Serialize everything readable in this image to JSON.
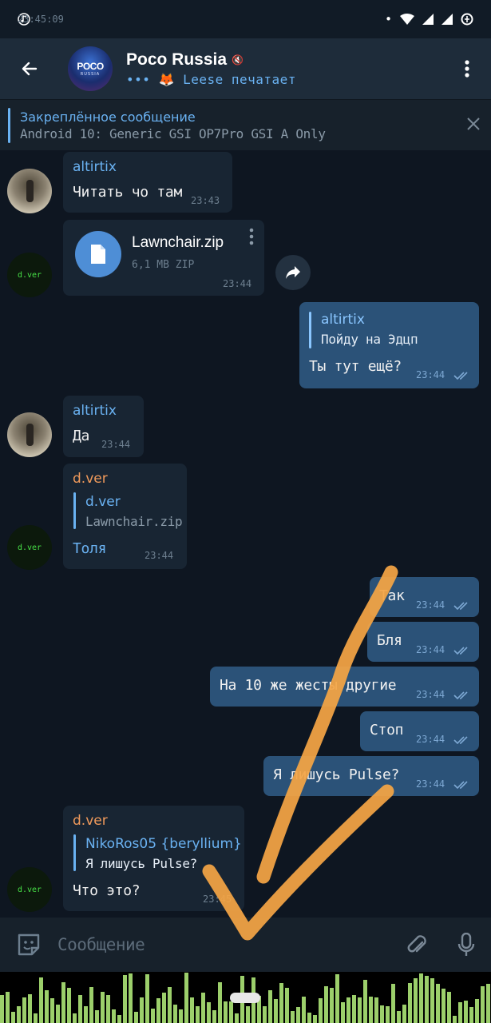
{
  "status_bar": {
    "time": "23:45:09"
  },
  "header": {
    "title": "Poco Russia",
    "status": "••• 🦊 Leese печатает",
    "avatar_line1": "POCO",
    "avatar_line2": "RUSSIA"
  },
  "pinned": {
    "title": "Закреплённое сообщение",
    "text": "Android 10: Generic GSI OP7Pro GSI A Only"
  },
  "messages": [
    {
      "sender": "altirtix",
      "text": "Читать чо там",
      "time": "23:43"
    },
    {
      "file_name": "Lawnchair.zip",
      "file_size": "6,1 MB ZIP",
      "time": "23:44"
    },
    {
      "reply_to": "altirtix",
      "reply_text": "Пойду на Эдцп",
      "text": "Ты тут ещё?",
      "time": "23:44"
    },
    {
      "sender": "altirtix",
      "text": "Да",
      "time": "23:44"
    },
    {
      "sender": "d.ver",
      "reply_to": "d.ver",
      "reply_text": "Lawnchair.zip",
      "text": "Толя",
      "time": "23:44"
    },
    {
      "text": "Так",
      "time": "23:44"
    },
    {
      "text": "Бля",
      "time": "23:44"
    },
    {
      "text": "На 10 же жесты другие",
      "time": "23:44"
    },
    {
      "text": "Стоп",
      "time": "23:44"
    },
    {
      "text": "Я лишусь Pulse?",
      "time": "23:44"
    },
    {
      "sender": "d.ver",
      "reply_to": "NikoRos05 {beryllium}",
      "reply_text": "Я лишусь Pulse?",
      "text": "Что это?",
      "time": "23:45"
    }
  ],
  "avatars": {
    "dver_label": "d.ver"
  },
  "input": {
    "placeholder": "Сообщение"
  },
  "colors": {
    "accent": "#6ab2f2",
    "outgoing": "#2b5278",
    "incoming": "#182533",
    "drawing": "#f4a545"
  }
}
